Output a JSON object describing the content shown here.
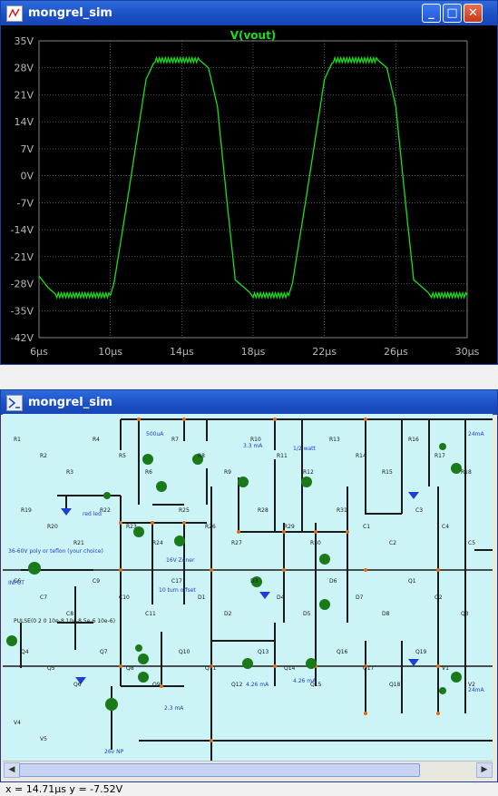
{
  "top_window": {
    "title": "mongrel_sim",
    "trace_name": "V(vout)",
    "trace_color": "#18e018",
    "y_ticks": [
      "35V",
      "28V",
      "21V",
      "14V",
      "7V",
      "0V",
      "-7V",
      "-14V",
      "-21V",
      "-28V",
      "-35V",
      "-42V"
    ],
    "x_ticks": [
      "6µs",
      "10µs",
      "14µs",
      "18µs",
      "22µs",
      "26µs",
      "30µs"
    ],
    "controls": {
      "minimize": "_",
      "maximize": "□",
      "close": "✕"
    }
  },
  "chart_data": {
    "type": "line",
    "title": "V(vout)",
    "xlabel": "",
    "ylabel": "",
    "xlim": [
      6,
      30
    ],
    "ylim": [
      -42,
      35
    ],
    "x_unit": "µs",
    "y_unit": "V",
    "grid": true,
    "series": [
      {
        "name": "V(vout)",
        "x": [
          6,
          6.5,
          7,
          8,
          9,
          10,
          10.2,
          11,
          11.5,
          12,
          12.5,
          14,
          15,
          15.5,
          16,
          16.5,
          17,
          18,
          19,
          20,
          20.2,
          21,
          21.5,
          22,
          22.5,
          24,
          25,
          25.5,
          26,
          26.5,
          27,
          28,
          29,
          30
        ],
        "y": [
          -26,
          -29,
          -31,
          -31,
          -31,
          -31,
          -28,
          -5,
          10,
          25,
          30,
          30,
          30,
          28,
          18,
          -5,
          -27,
          -31,
          -31,
          -31,
          -28,
          -5,
          10,
          25,
          30,
          30,
          30,
          28,
          18,
          -5,
          -27,
          -31,
          -31,
          -31
        ]
      }
    ]
  },
  "bottom_window": {
    "title": "mongrel_sim",
    "labels": {
      "input_header": "36-60V poly or teflon (your choice)",
      "input": "INPUT",
      "pulse": "PULSE(0 2 0 10e-8 10e-8 5e-6 10e-6)",
      "bias_note": "26v NP",
      "current_500": "500uA",
      "current_33": "3.3 mA",
      "current_24a": "24mA",
      "current_24b": "24mA",
      "current_426a": "4.26 mA",
      "current_426b": "4.26 mA",
      "current_23": "2.3 mA",
      "watt": "1/2 watt",
      "zener": "16V Zener",
      "trim": "10 turn offset",
      "redled": "red led"
    },
    "parts": [
      "R1",
      "R2",
      "R3",
      "R4",
      "R5",
      "R6",
      "R7",
      "R8",
      "R9",
      "R10",
      "R11",
      "R12",
      "R13",
      "R14",
      "R15",
      "R16",
      "R17",
      "R18",
      "R19",
      "R20",
      "R21",
      "R22",
      "R23",
      "R24",
      "R25",
      "R26",
      "R27",
      "R28",
      "R29",
      "R30",
      "R31",
      "C1",
      "C2",
      "C3",
      "C4",
      "C5",
      "C6",
      "C7",
      "C8",
      "C9",
      "C10",
      "C11",
      "C17",
      "D1",
      "D2",
      "D3",
      "D4",
      "D5",
      "D6",
      "D7",
      "D8",
      "Q1",
      "Q2",
      "Q3",
      "Q4",
      "Q5",
      "Q6",
      "Q7",
      "Q8",
      "Q9",
      "Q10",
      "Q11",
      "Q12",
      "Q13",
      "Q14",
      "Q15",
      "Q16",
      "Q17",
      "Q18",
      "Q19",
      "V1",
      "V2",
      "V4",
      "V5"
    ],
    "controls": {
      "scroll_left": "◀",
      "scroll_right": "▶"
    }
  },
  "status": {
    "cursor_readout": "x = 14.71µs   y = -7.52V"
  }
}
